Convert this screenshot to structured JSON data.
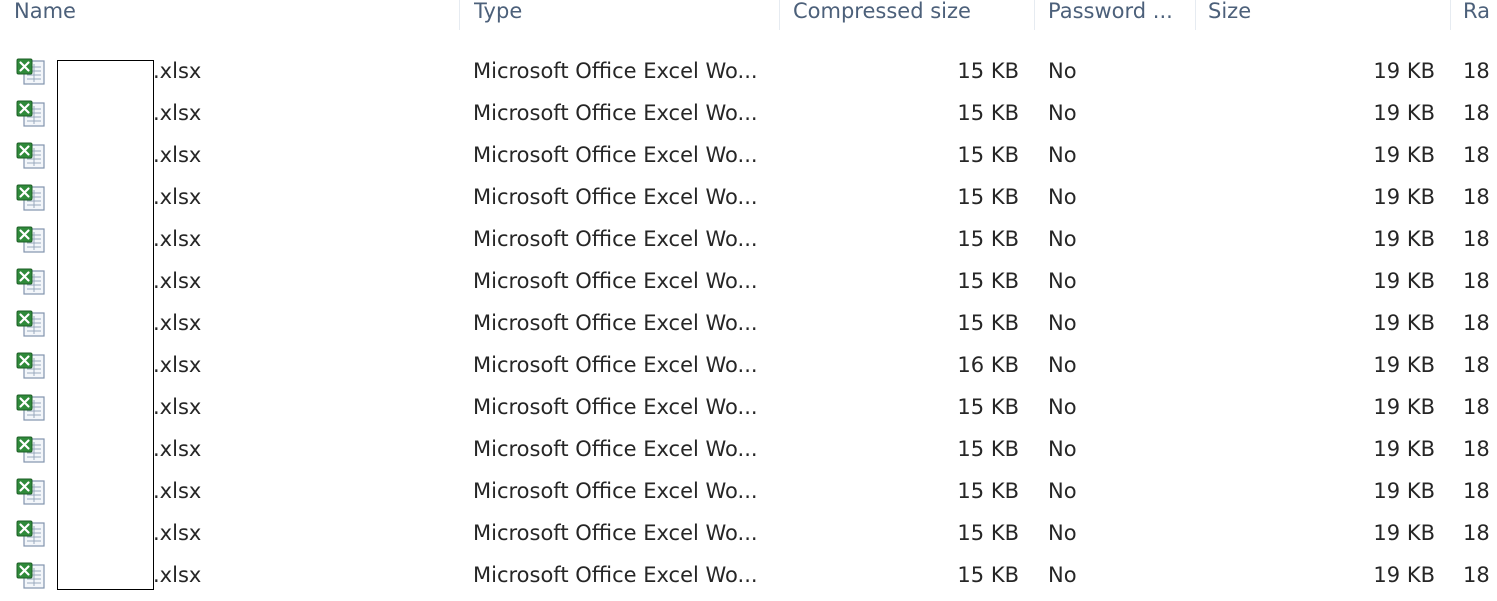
{
  "columns": {
    "name": "Name",
    "type": "Type",
    "compressed": "Compressed size",
    "password": "Password ...",
    "size": "Size",
    "ratio": "Ra"
  },
  "icon": "excel-file-icon",
  "rows": [
    {
      "name": ".xlsx",
      "type": "Microsoft Office Excel Wo...",
      "compressed": "15 KB",
      "password": "No",
      "size": "19 KB",
      "ratio": "18"
    },
    {
      "name": ".xlsx",
      "type": "Microsoft Office Excel Wo...",
      "compressed": "15 KB",
      "password": "No",
      "size": "19 KB",
      "ratio": "18"
    },
    {
      "name": ".xlsx",
      "type": "Microsoft Office Excel Wo...",
      "compressed": "15 KB",
      "password": "No",
      "size": "19 KB",
      "ratio": "18"
    },
    {
      "name": ".xlsx",
      "type": "Microsoft Office Excel Wo...",
      "compressed": "15 KB",
      "password": "No",
      "size": "19 KB",
      "ratio": "18"
    },
    {
      "name": ".xlsx",
      "type": "Microsoft Office Excel Wo...",
      "compressed": "15 KB",
      "password": "No",
      "size": "19 KB",
      "ratio": "18"
    },
    {
      "name": ".xlsx",
      "type": "Microsoft Office Excel Wo...",
      "compressed": "15 KB",
      "password": "No",
      "size": "19 KB",
      "ratio": "18"
    },
    {
      "name": ".xlsx",
      "type": "Microsoft Office Excel Wo...",
      "compressed": "15 KB",
      "password": "No",
      "size": "19 KB",
      "ratio": "18"
    },
    {
      "name": ".xlsx",
      "type": "Microsoft Office Excel Wo...",
      "compressed": "16 KB",
      "password": "No",
      "size": "19 KB",
      "ratio": "18"
    },
    {
      "name": ".xlsx",
      "type": "Microsoft Office Excel Wo...",
      "compressed": "15 KB",
      "password": "No",
      "size": "19 KB",
      "ratio": "18"
    },
    {
      "name": ".xlsx",
      "type": "Microsoft Office Excel Wo...",
      "compressed": "15 KB",
      "password": "No",
      "size": "19 KB",
      "ratio": "18"
    },
    {
      "name": ".xlsx",
      "type": "Microsoft Office Excel Wo...",
      "compressed": "15 KB",
      "password": "No",
      "size": "19 KB",
      "ratio": "18"
    },
    {
      "name": ".xlsx",
      "type": "Microsoft Office Excel Wo...",
      "compressed": "15 KB",
      "password": "No",
      "size": "19 KB",
      "ratio": "18"
    },
    {
      "name": ".xlsx",
      "type": "Microsoft Office Excel Wo...",
      "compressed": "15 KB",
      "password": "No",
      "size": "19 KB",
      "ratio": "18"
    }
  ]
}
